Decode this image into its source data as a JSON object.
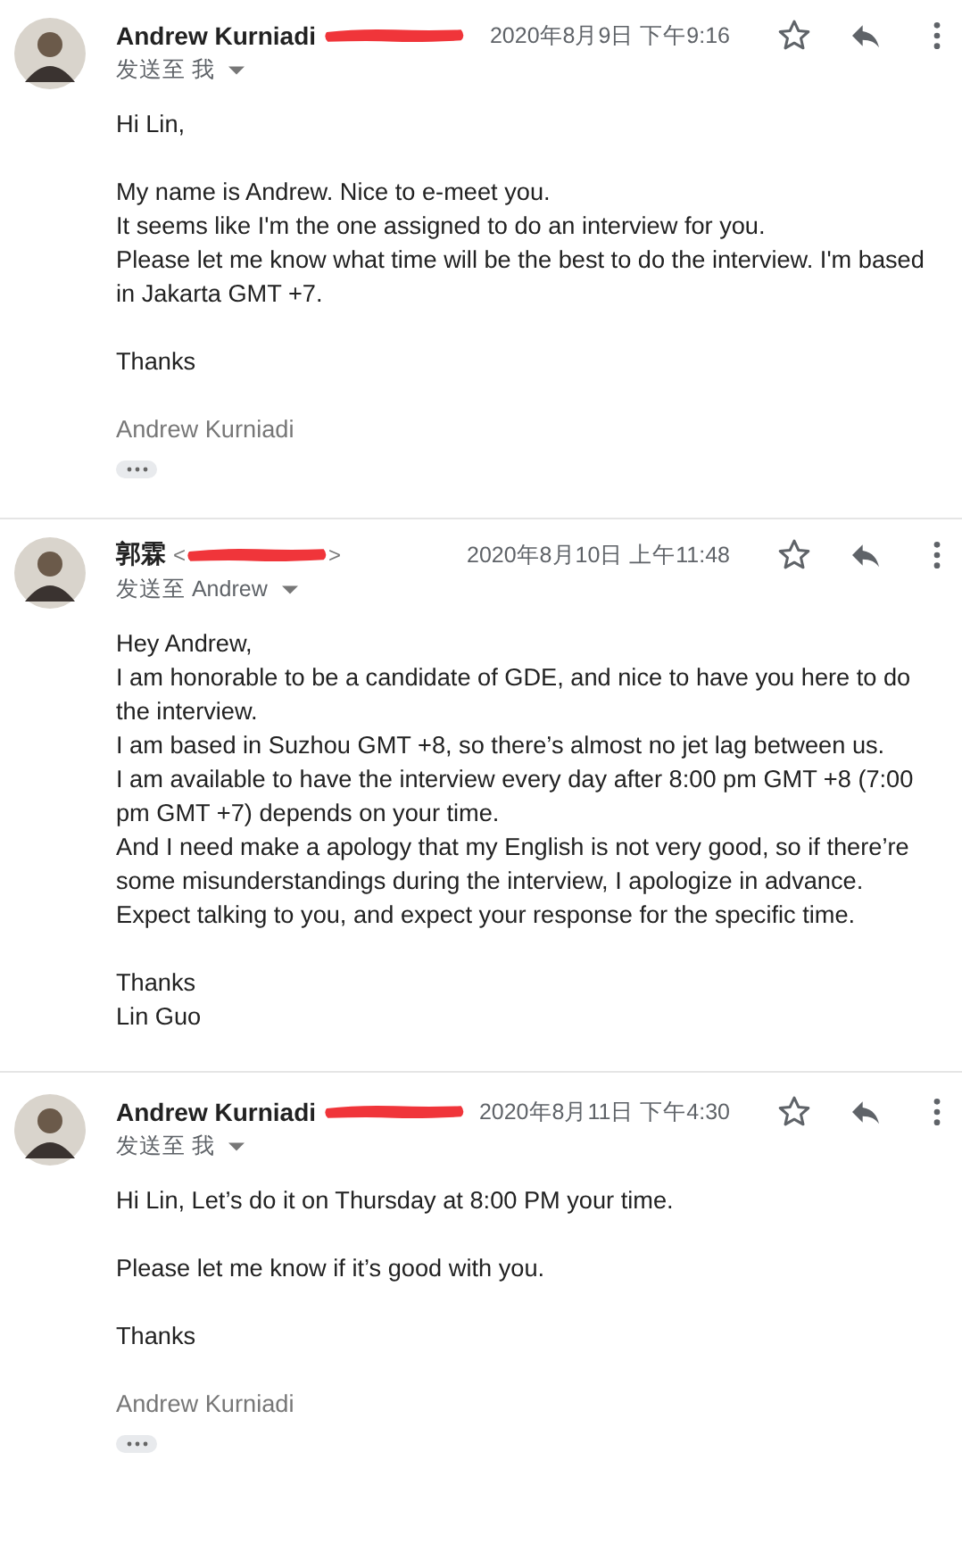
{
  "messages": [
    {
      "sender": "Andrew Kurniadi",
      "email_redacted": true,
      "date": "2020年8月9日 下午9:16",
      "recipients": "发送至 我",
      "body": [
        [
          "Hi Lin,"
        ],
        [
          "My name is Andrew. Nice to e-meet you.",
          "It seems like I'm the one assigned to do an interview for you.",
          "Please let me know what time will be the best to do the interview. I'm based in Jakarta GMT +7."
        ],
        [
          "Thanks"
        ]
      ],
      "signature": "Andrew Kurniadi",
      "trimmed_content": true
    },
    {
      "sender": "郭霖",
      "email_open": "<",
      "email_close": ">",
      "email_redacted": true,
      "date": "2020年8月10日 上午11:48",
      "recipients": "发送至 Andrew",
      "body": [
        [
          "Hey Andrew,",
          "I am honorable to be a candidate of GDE, and nice to have you here to do the interview.",
          "I am based in Suzhou GMT +8, so there’s almost no jet lag between us.",
          "I am available to have the interview every day after 8:00 pm GMT +8 (7:00 pm GMT +7) depends on your time.",
          "And I need make a apology that my English is not very good, so if there’re some misunderstandings during the interview, I apologize in advance.",
          "Expect talking to you, and expect your response for the specific time."
        ],
        [
          "Thanks",
          "Lin Guo"
        ]
      ],
      "trimmed_content": false
    },
    {
      "sender": "Andrew Kurniadi",
      "email_redacted": true,
      "date": "2020年8月11日 下午4:30",
      "recipients": "发送至 我",
      "body": [
        [
          "Hi Lin, Let’s do it on Thursday at 8:00 PM your time."
        ],
        [
          "Please let me know if it’s good with you."
        ],
        [
          "Thanks"
        ]
      ],
      "signature": "Andrew Kurniadi",
      "trimmed_content": true
    }
  ]
}
